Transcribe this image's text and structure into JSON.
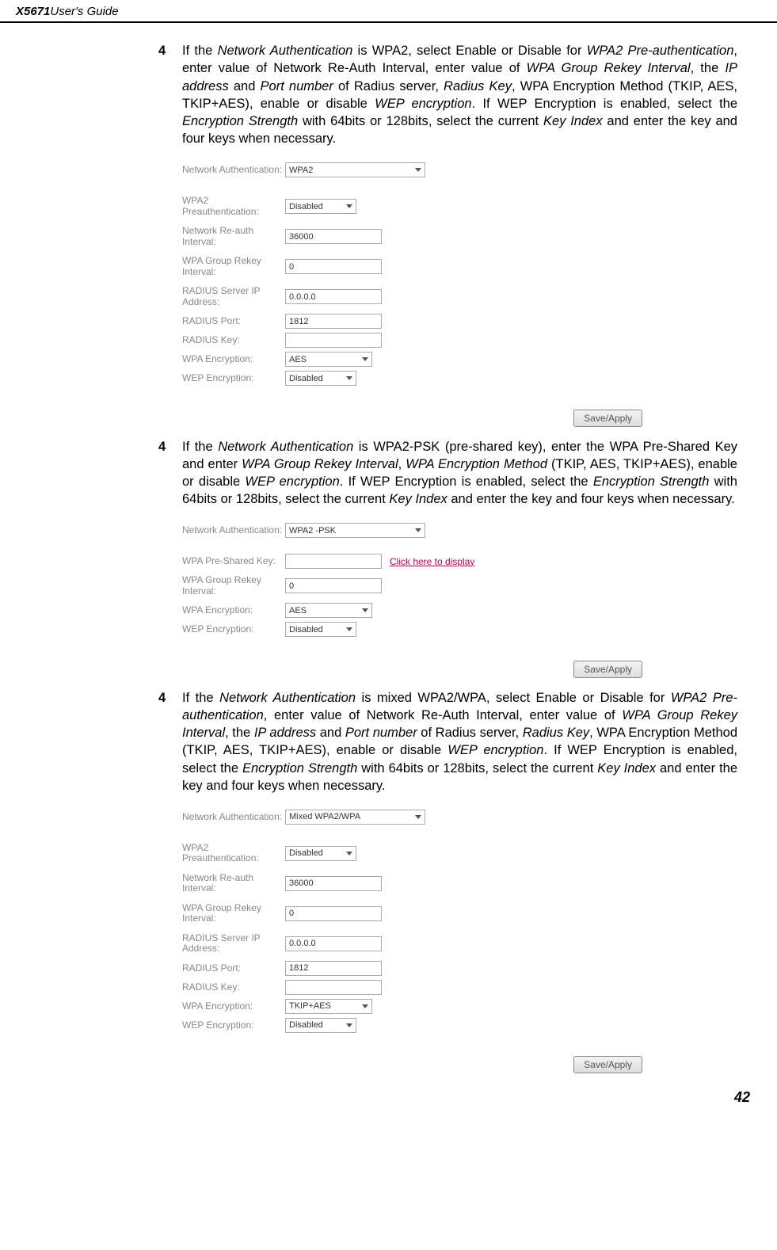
{
  "header": {
    "model": "X5671",
    "rest": " User's Guide"
  },
  "p1": {
    "num": "4",
    "t1": "If the ",
    "t2": "Network Authentication",
    "t3": " is WPA2, select Enable or Disable for ",
    "t4": "WPA2 Pre-authentication",
    "t5": ", enter value of Network Re-Auth Interval, enter value of ",
    "t6": "WPA Group Rekey Interval",
    "t7": ", the ",
    "t8": "IP address",
    "t9": " and ",
    "t10": "Port number",
    "t11": " of Radius server, ",
    "t12": "Radius Key",
    "t13": ", WPA Encryption Method (TKIP, AES, TKIP+AES), enable or disable ",
    "t14": "WEP encryption",
    "t15": ". If WEP Encryption is enabled, select the ",
    "t16": "Encryption Strength",
    "t17": " with 64bits or 128bits, select the current ",
    "t18": "Key Index",
    "t19": " and enter the key and four keys when necessary."
  },
  "s1": {
    "lbl_netauth": "Network Authentication:",
    "val_netauth": "WPA2",
    "lbl_preauth": "WPA2 Preauthentication:",
    "val_preauth": "Disabled",
    "lbl_reauth": "Network Re-auth Interval:",
    "val_reauth": "36000",
    "lbl_rekey": "WPA Group Rekey Interval:",
    "val_rekey": "0",
    "lbl_radip": "RADIUS Server IP Address:",
    "val_radip": "0.0.0.0",
    "lbl_radport": "RADIUS Port:",
    "val_radport": "1812",
    "lbl_radkey": "RADIUS Key:",
    "val_radkey": "",
    "lbl_wpaenc": "WPA Encryption:",
    "val_wpaenc": "AES",
    "lbl_wepenc": "WEP Encryption:",
    "val_wepenc": "Disabled",
    "btn": "Save/Apply"
  },
  "p2": {
    "num": "4",
    "t1": "If the ",
    "t2": "Network Authentication",
    "t3": " is WPA2-PSK (pre-shared key), enter the WPA Pre-Shared Key and enter ",
    "t4": "WPA Group Rekey Interval",
    "t5": ", ",
    "t6": "WPA Encryption Method",
    "t7": " (TKIP, AES, TKIP+AES), enable or disable ",
    "t8": "WEP encryption",
    "t9": ". If WEP Encryption is enabled, select the ",
    "t10": "Encryption Strength",
    "t11": " with 64bits or 128bits, select the current ",
    "t12": "Key Index",
    "t13": " and enter the key and four keys when necessary."
  },
  "s2": {
    "lbl_netauth": "Network Authentication:",
    "val_netauth": "WPA2 -PSK",
    "lbl_psk": "WPA Pre-Shared Key:",
    "val_psk": "",
    "link_psk": "Click here to display",
    "lbl_rekey": "WPA Group Rekey Interval:",
    "val_rekey": "0",
    "lbl_wpaenc": "WPA Encryption:",
    "val_wpaenc": "AES",
    "lbl_wepenc": "WEP Encryption:",
    "val_wepenc": "Disabled",
    "btn": "Save/Apply"
  },
  "p3": {
    "num": "4",
    "t1": "If the ",
    "t2": "Network Authentication",
    "t3": " is mixed WPA2/WPA, select Enable or Disable for ",
    "t4": "WPA2 Pre-authentication",
    "t5": ", enter value of Network Re-Auth Interval, enter value of ",
    "t6": "WPA Group Rekey Interval",
    "t7": ", the ",
    "t8": "IP address",
    "t9": " and ",
    "t10": "Port number",
    "t11": " of Radius server, ",
    "t12": "Radius Key",
    "t13": ", WPA Encryption Method (TKIP, AES, TKIP+AES), enable or disable ",
    "t14": "WEP encryption",
    "t15": ". If WEP Encryption is enabled, select the ",
    "t16": "Encryption Strength",
    "t17": " with 64bits or 128bits, select the current ",
    "t18": "Key Index",
    "t19": " and enter the key and four keys when necessary."
  },
  "s3": {
    "lbl_netauth": "Network Authentication:",
    "val_netauth": "Mixed WPA2/WPA",
    "lbl_preauth": "WPA2 Preauthentication:",
    "val_preauth": "Disabled",
    "lbl_reauth": "Network Re-auth Interval:",
    "val_reauth": "36000",
    "lbl_rekey": "WPA Group Rekey Interval:",
    "val_rekey": "0",
    "lbl_radip": "RADIUS Server IP Address:",
    "val_radip": "0.0.0.0",
    "lbl_radport": "RADIUS Port:",
    "val_radport": "1812",
    "lbl_radkey": "RADIUS Key:",
    "val_radkey": "",
    "lbl_wpaenc": "WPA Encryption:",
    "val_wpaenc": "TKIP+AES",
    "lbl_wepenc": "WEP Encryption:",
    "val_wepenc": "Disabled",
    "btn": "Save/Apply"
  },
  "pagenum": "42"
}
